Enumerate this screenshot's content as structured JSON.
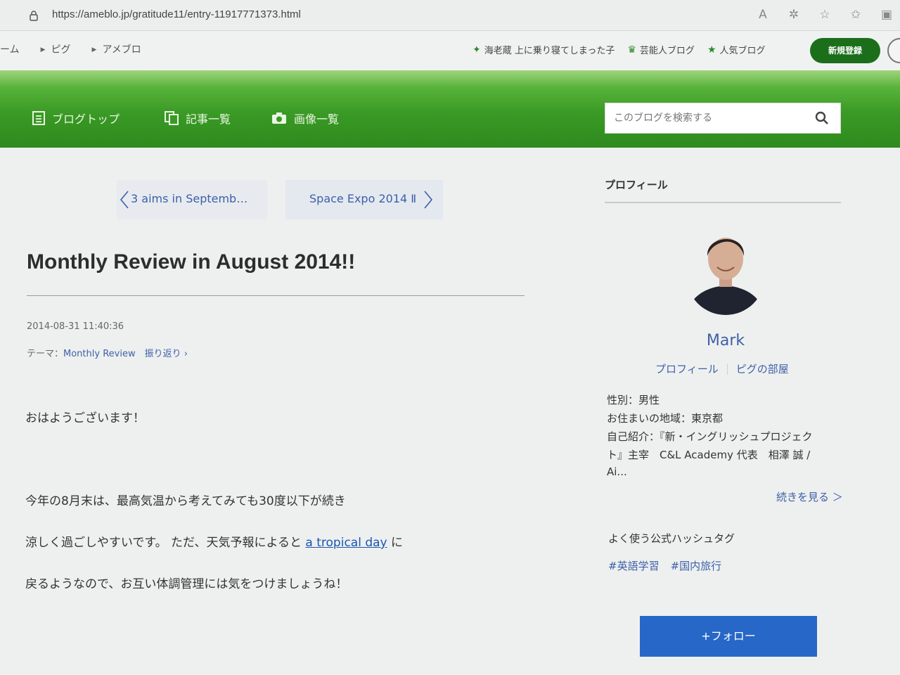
{
  "browser": {
    "url": "https://ameblo.jp/gratitude11/entry-11917771373.html",
    "icons": [
      "read-aloud-icon",
      "extension-icon",
      "favorites-add-icon",
      "favorites-icon",
      "collections-icon"
    ]
  },
  "ameba_header": {
    "breadcrumbs": [
      "ーム",
      "ピグ",
      "アメブロ"
    ],
    "links": [
      {
        "label": "海老蔵 上に乗り寝てしまった子",
        "icon": "sparkle-icon"
      },
      {
        "label": "芸能人ブログ",
        "icon": "crown-icon"
      },
      {
        "label": "人気ブログ",
        "icon": "star-icon"
      }
    ],
    "signup_label": "新規登録"
  },
  "blog_nav": {
    "items": [
      {
        "label": "ブログトップ",
        "icon": "document-icon"
      },
      {
        "label": "記事一覧",
        "icon": "copy-icon"
      },
      {
        "label": "画像一覧",
        "icon": "camera-icon"
      }
    ],
    "search_placeholder": "このブログを検索する"
  },
  "pager": {
    "prev": "3 aims in Septemb…",
    "next": "Space Expo 2014 Ⅱ"
  },
  "post": {
    "title": "Monthly Review in August 2014!!",
    "date": "2014-08-31 11:40:36",
    "theme_prefix": "テーマ：",
    "theme": "Monthly Review",
    "theme_extra": "振り返り",
    "greeting": "おはようございます！",
    "line1": "今年の8月末は、最高気温から考えてみても30度以下が続き",
    "line2_before": "涼しく過ごしやすいです。 ただ、天気予報によると",
    "line2_link": "a tropical day",
    "line2_after": "に",
    "line3": "戻るようなので、お互い体調管理には気をつけましょうね！"
  },
  "sidebar": {
    "heading": "プロフィール",
    "name": "Mark",
    "link_profile": "プロフィール",
    "link_room": "ピグの部屋",
    "gender": "性別：男性",
    "region": "お住まいの地域：東京都",
    "intro_1": "自己紹介：『新・イングリッシュプロジェク",
    "intro_2": "ト』主宰　C&L Academy 代表　相澤 誠 /",
    "intro_3": "Ai...",
    "more": "続きを見る ＞",
    "hashtag_heading": "よく使う公式ハッシュタグ",
    "hashtags": [
      "#英語学習",
      "#国内旅行"
    ],
    "follow": "+フォロー"
  },
  "colors": {
    "nav_green": "#3a9a25",
    "link_blue": "#3e5fa8",
    "follow_blue": "#2767c8",
    "signup_green": "#1b6f1b"
  }
}
